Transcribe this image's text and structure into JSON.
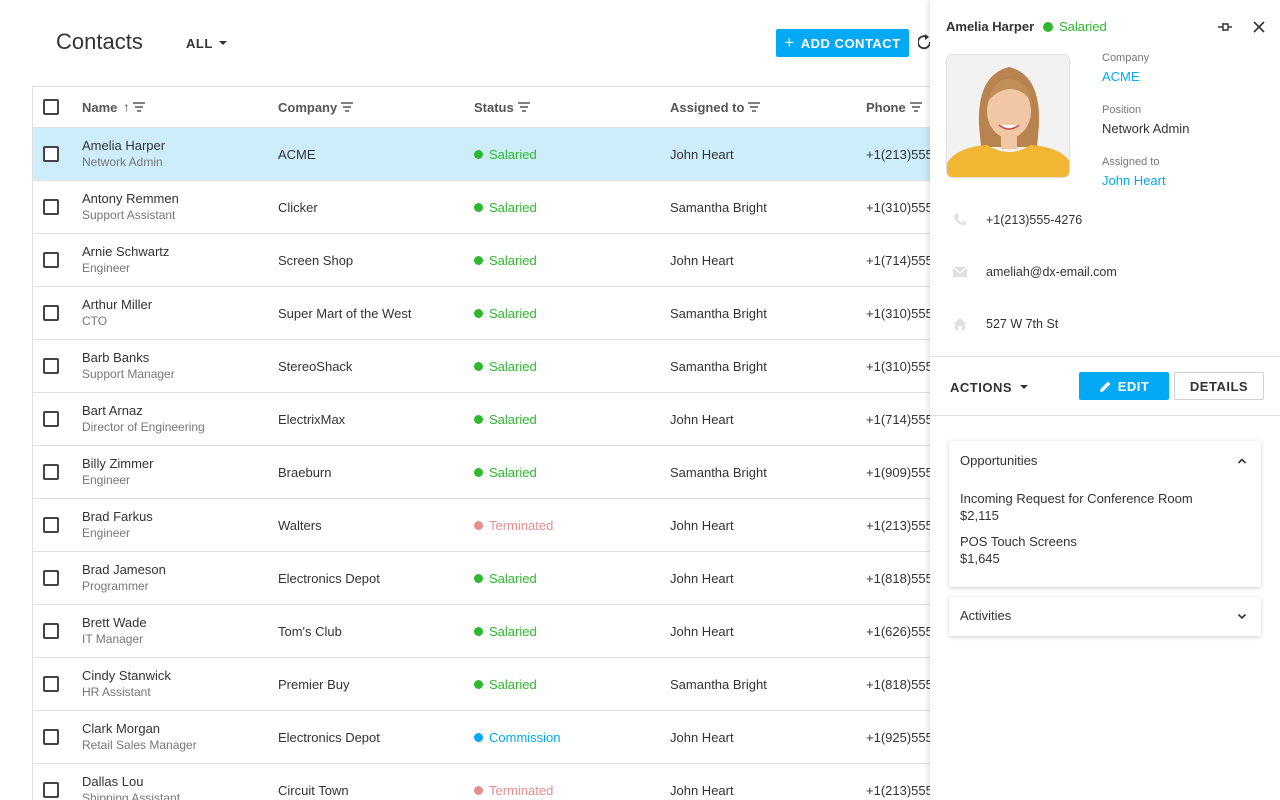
{
  "toolbar": {
    "title": "Contacts",
    "filter_label": "ALL",
    "add_label": "ADD CONTACT"
  },
  "grid": {
    "columns": [
      "Name",
      "Company",
      "Status",
      "Assigned to",
      "Phone"
    ],
    "rows": [
      {
        "name": "Amelia Harper",
        "position": "Network Admin",
        "company": "ACME",
        "status": "Salaried",
        "assigned": "John Heart",
        "phone": "+1(213)555"
      },
      {
        "name": "Antony Remmen",
        "position": "Support Assistant",
        "company": "Clicker",
        "status": "Salaried",
        "assigned": "Samantha Bright",
        "phone": "+1(310)555"
      },
      {
        "name": "Arnie Schwartz",
        "position": "Engineer",
        "company": "Screen Shop",
        "status": "Salaried",
        "assigned": "John Heart",
        "phone": "+1(714)555"
      },
      {
        "name": "Arthur Miller",
        "position": "CTO",
        "company": "Super Mart of the West",
        "status": "Salaried",
        "assigned": "Samantha Bright",
        "phone": "+1(310)555"
      },
      {
        "name": "Barb Banks",
        "position": "Support Manager",
        "company": "StereoShack",
        "status": "Salaried",
        "assigned": "Samantha Bright",
        "phone": "+1(310)555"
      },
      {
        "name": "Bart Arnaz",
        "position": "Director of Engineering",
        "company": "ElectrixMax",
        "status": "Salaried",
        "assigned": "John Heart",
        "phone": "+1(714)555"
      },
      {
        "name": "Billy Zimmer",
        "position": "Engineer",
        "company": "Braeburn",
        "status": "Salaried",
        "assigned": "Samantha Bright",
        "phone": "+1(909)555"
      },
      {
        "name": "Brad Farkus",
        "position": "Engineer",
        "company": "Walters",
        "status": "Terminated",
        "assigned": "John Heart",
        "phone": "+1(213)555"
      },
      {
        "name": "Brad Jameson",
        "position": "Programmer",
        "company": "Electronics Depot",
        "status": "Salaried",
        "assigned": "John Heart",
        "phone": "+1(818)555"
      },
      {
        "name": "Brett Wade",
        "position": "IT Manager",
        "company": "Tom's Club",
        "status": "Salaried",
        "assigned": "John Heart",
        "phone": "+1(626)555"
      },
      {
        "name": "Cindy Stanwick",
        "position": "HR Assistant",
        "company": "Premier Buy",
        "status": "Salaried",
        "assigned": "Samantha Bright",
        "phone": "+1(818)555"
      },
      {
        "name": "Clark Morgan",
        "position": "Retail Sales Manager",
        "company": "Electronics Depot",
        "status": "Commission",
        "assigned": "John Heart",
        "phone": "+1(925)555"
      },
      {
        "name": "Dallas Lou",
        "position": "Shipping Assistant",
        "company": "Circuit Town",
        "status": "Terminated",
        "assigned": "John Heart",
        "phone": "+1(213)555"
      }
    ]
  },
  "status_colors": {
    "Salaried": "#2eb82e",
    "Terminated": "#e58e8e",
    "Commission": "#03a9f4"
  },
  "panel": {
    "name": "Amelia Harper",
    "status": "Salaried",
    "company_label": "Company",
    "company": "ACME",
    "position_label": "Position",
    "position": "Network Admin",
    "assigned_label": "Assigned to",
    "assigned": "John Heart",
    "phone": "+1(213)555-4276",
    "email": "ameliah@dx-email.com",
    "address": "527 W 7th St",
    "actions_label": "ACTIONS",
    "edit_label": "EDIT",
    "details_label": "DETAILS",
    "opportunities_title": "Opportunities",
    "opportunities": [
      {
        "name": "Incoming Request for Conference Room",
        "amount": "$2,115"
      },
      {
        "name": "POS Touch Screens",
        "amount": "$1,645"
      }
    ],
    "activities_title": "Activities"
  },
  "icons": {
    "refresh": "refresh-icon",
    "pin": "pin-icon",
    "close": "close-icon",
    "phone": "phone-icon",
    "email": "email-icon",
    "address": "home-icon",
    "edit": "pencil-icon"
  }
}
